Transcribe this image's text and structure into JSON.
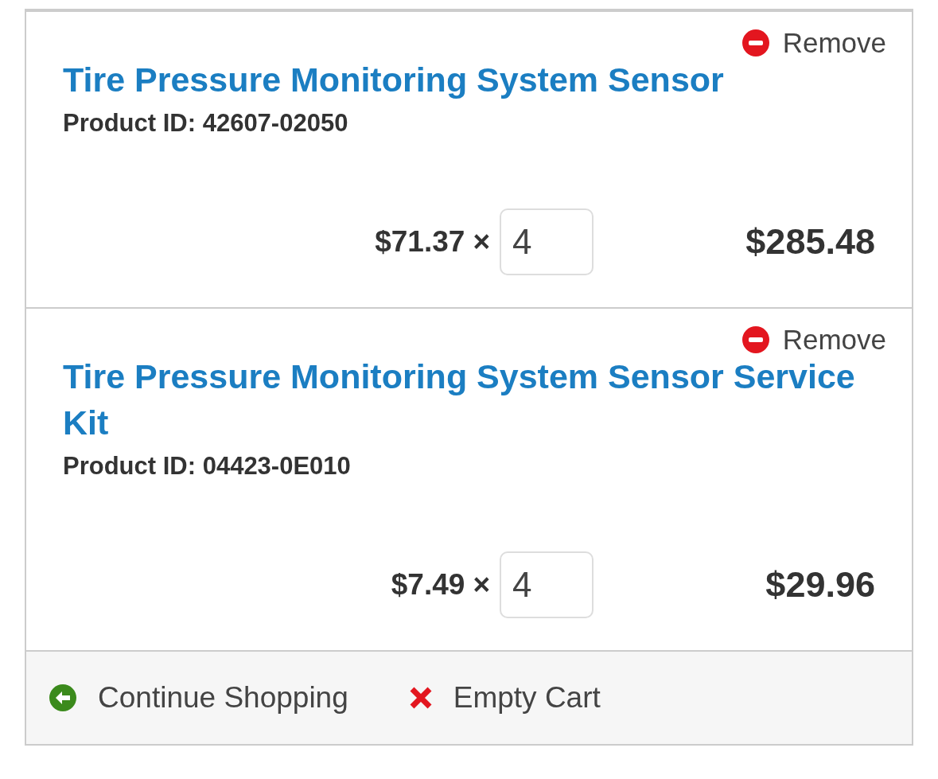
{
  "cart_items": [
    {
      "remove": "Remove",
      "title": "Tire Pressure Monitoring System Sensor",
      "product_id": "Product ID: 42607-02050",
      "unit_price": "$71.37",
      "times": "×",
      "quantity": "4",
      "line_total": "$285.48"
    },
    {
      "remove": "Remove",
      "title": "Tire Pressure Monitoring System Sensor Service Kit",
      "product_id": "Product ID: 04423-0E010",
      "unit_price": "$7.49",
      "times": "×",
      "quantity": "4",
      "line_total": "$29.96"
    }
  ],
  "footer": {
    "actions": [
      {
        "kind": "continue",
        "label": "Continue Shopping"
      },
      {
        "kind": "empty",
        "label": "Empty Cart"
      }
    ]
  }
}
